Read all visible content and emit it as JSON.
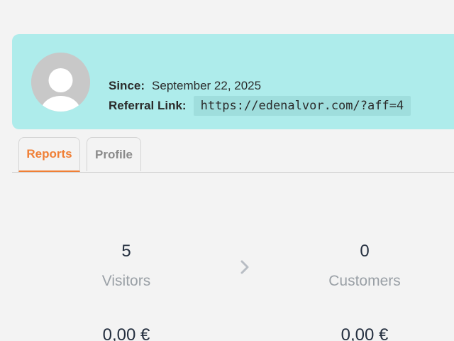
{
  "profile": {
    "since_label": "Since:",
    "since_value": "September 22, 2025",
    "referral_label": "Referral Link:",
    "referral_link": "https://edenalvor.com/?aff=4",
    "avatar_icon": "user-avatar-icon"
  },
  "tabs": [
    {
      "label": "Reports",
      "active": true
    },
    {
      "label": "Profile",
      "active": false
    }
  ],
  "stats": {
    "visitors": {
      "value": "5",
      "label": "Visitors"
    },
    "customers": {
      "value": "0",
      "label": "Customers"
    },
    "arrow_icon": "chevron-right-icon",
    "revenue_left": "0,00 €",
    "revenue_right": "0,00 €"
  },
  "colors": {
    "header_bg": "#aeeceb",
    "accent": "#f07f35",
    "page_bg": "#f3f3f3"
  }
}
